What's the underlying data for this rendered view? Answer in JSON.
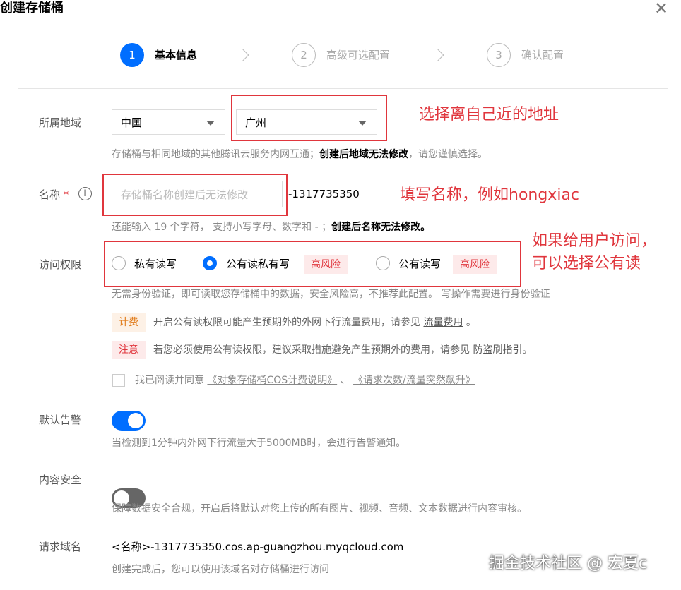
{
  "dialog": {
    "title": "创建存储桶",
    "close_glyph": "✕"
  },
  "steps": [
    {
      "num": "1",
      "label": "基本信息"
    },
    {
      "num": "2",
      "label": "高级可选配置"
    },
    {
      "num": "3",
      "label": "确认配置"
    }
  ],
  "region": {
    "label": "所属地域",
    "country": "中国",
    "city": "广州",
    "hint_prefix": "存储桶与相同地域的其他腾讯云服务内网互通；",
    "hint_bold": "创建后地域无法修改",
    "hint_suffix": "，请您谨慎选择。"
  },
  "name": {
    "label": "名称",
    "required_mark": "*",
    "info_glyph": "i",
    "placeholder": "存储桶名称创建后无法修改",
    "suffix": "-1317735350",
    "hint_prefix": "还能输入 19 个字符， 支持小写字母、数字和 - ；",
    "hint_bold": "创建后名称无法修改。"
  },
  "access": {
    "label": "访问权限",
    "options": [
      {
        "label": "私有读写",
        "risk": ""
      },
      {
        "label": "公有读私有写",
        "risk": "高风险"
      },
      {
        "label": "公有读写",
        "risk": "高风险"
      }
    ],
    "selected_index": 1,
    "description": "无需身份验证，即可读取您存储桶中的数据，安全风险高，不推荐此配置。 写操作需要进行身份验证",
    "fee_tag": "计费",
    "fee_text": "开启公有读权限可能产生预期外的外网下行流量费用，请参见",
    "fee_link": "流量费用",
    "fee_end": "。",
    "note_tag": "注意",
    "note_text": "若您必须使用公有读权限，建议采取措施避免产生预期外的费用，请参见",
    "note_link": "防盗刷指引",
    "note_end": "。",
    "agree_text": "我已阅读并同意",
    "agree_link1": "《对象存储桶COS计费说明》",
    "agree_sep": "、",
    "agree_link2": "《请求次数/流量突然飙升》"
  },
  "alarm": {
    "label": "默认告警",
    "enabled": true,
    "hint": "当检测到1分钟内外网下行流量大于5000MB时，会进行告警通知。"
  },
  "content_security": {
    "label": "内容安全",
    "enabled": false,
    "hint": "保障数据安全合规，开启后将默认对您上传的所有图片、视频、音频、文本数据进行内容审核。"
  },
  "request_domain": {
    "label": "请求域名",
    "value": "<名称>-1317735350.cos.ap-guangzhou.myqcloud.com",
    "hint": "创建完成后，您可以使用该域名对存储桶进行访问"
  },
  "annotations": {
    "region": "选择离自己近的地址",
    "name": "填写名称，例如hongxiac",
    "access_line1": "如果给用户访问，",
    "access_line2": "可以选择公有读"
  },
  "watermark": "掘金技术社区 @ 宏夏c",
  "colors": {
    "primary": "#006eff",
    "annotation_red": "#e0363d"
  }
}
